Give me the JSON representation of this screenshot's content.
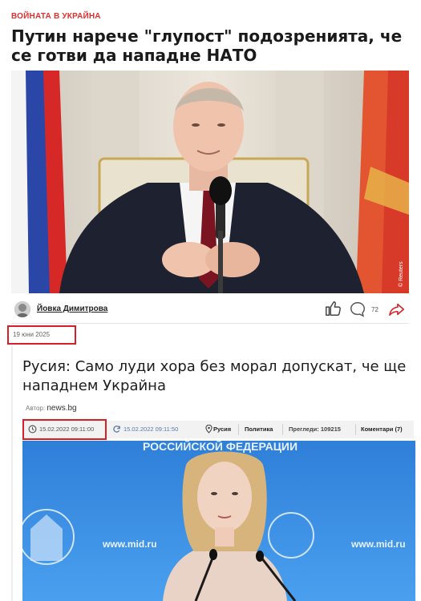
{
  "article1": {
    "category": "ВОЙНАТА В УКРАЙНА",
    "title": "Путин нарече \"глупост\" подозренията, че се готви да нападне НАТО",
    "photo_credit": "© Reuters",
    "author": "Йовка Димитрова",
    "comment_count": "72",
    "date": "19 юни 2025"
  },
  "article2": {
    "title": "Русия: Само луди хора без морал допускат, че ще нападнем Украйна",
    "author_label": "Автор:",
    "author": "news.bg",
    "published": "15.02.2022 09:11:00",
    "updated": "15.02.2022 09:11:50",
    "location": "Русия",
    "section": "Политика",
    "views_label": "Прегледи:",
    "views": "109215",
    "comments_label": "Коментари",
    "comments": "(7)",
    "backdrop_text_1": "РОССИЙСКОЙ ФЕДЕРАЦИИ",
    "backdrop_text_2": "www.mid.ru",
    "backdrop_text_3": "www.mid.ru"
  },
  "colors": {
    "accent_red": "#d61f26",
    "category_red": "#e0302f",
    "link_blue": "#5a7aa8",
    "backdrop_blue": "#3b8be0"
  },
  "icons": {
    "like": "thumbs-up-icon",
    "comment": "comment-bubble-icon",
    "share": "share-arrow-icon",
    "clock": "clock-icon",
    "refresh": "refresh-icon",
    "location": "location-pin-icon"
  }
}
